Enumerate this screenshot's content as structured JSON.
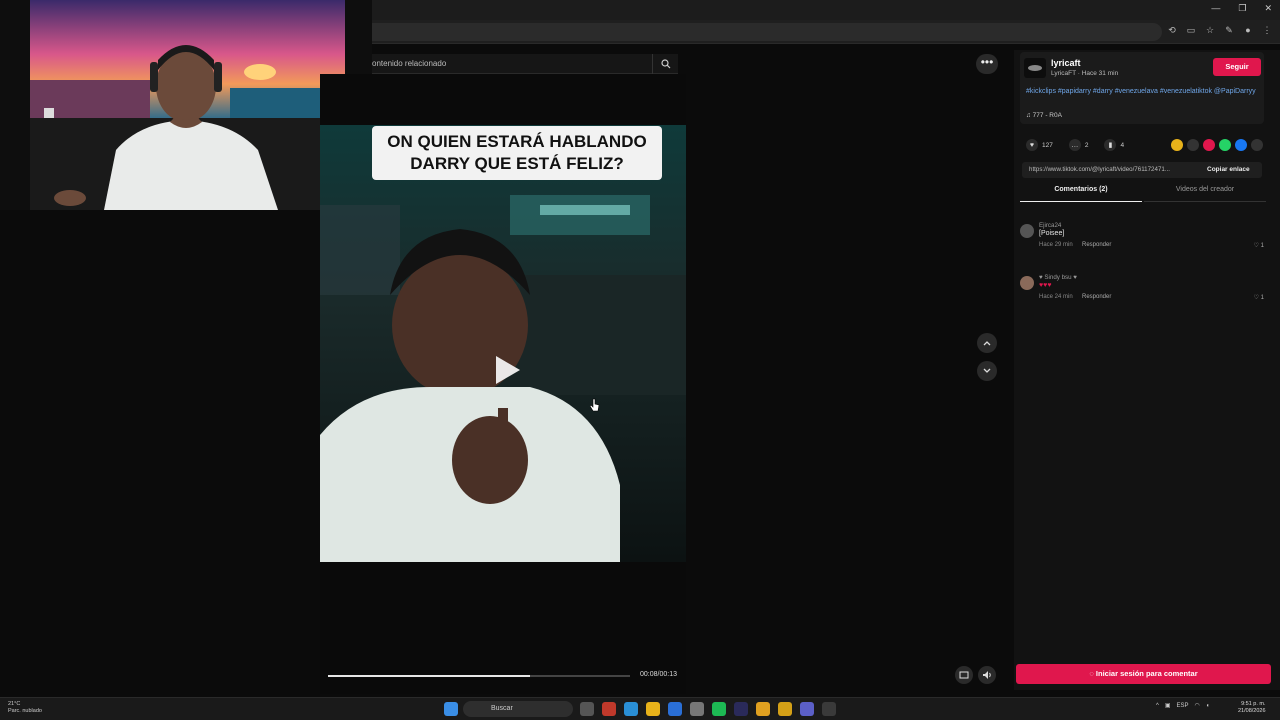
{
  "search": {
    "placeholder_text": "ontenido relacionado"
  },
  "video": {
    "caption_line1": "ON QUIEN ESTARÁ HABLANDO",
    "caption_line2": "DARRY QUE ESTÁ FELIZ?",
    "time": "00:08/00:13",
    "progress": 0.67
  },
  "creator": {
    "username": "lyricaft",
    "subline": "LyricaFT · Hace 31 min",
    "follow_label": "Seguir",
    "hashtags": "#kickclips #papidarry #darry #venezuelava #venezuelatiktok @PapiDarryy",
    "music": "♫ 777 - R0A"
  },
  "stats": {
    "likes": "127",
    "comments": "2",
    "saves": "4"
  },
  "link": {
    "url": "https://www.tiktok.com/@lyricaft/video/761172471...",
    "copy_label": "Copiar enlace"
  },
  "tabs": {
    "comments": "Comentarios (2)",
    "creator_videos": "Videos del creador"
  },
  "comments": [
    {
      "user": "Ejirca24",
      "text": "[Poisee]",
      "time": "Hace 29 min",
      "reply": "Responder",
      "likes": "1"
    },
    {
      "user": "♥ Sindy bsu ♥",
      "text": "♥♥♥",
      "time": "Hace 24 min",
      "reply": "Responder",
      "likes": "1"
    }
  ],
  "login_label": "Iniciar sesión para comentar",
  "taskbar": {
    "weather_temp": "21°C",
    "weather_desc": "Parc. nublado",
    "search_label": "Buscar",
    "lang": "ESP",
    "lang2": "LAA",
    "time": "9:51 p. m.",
    "date": "21/08/2026"
  },
  "colors": {
    "accent": "#e0174d",
    "hashtag": "#6fa6e8"
  }
}
